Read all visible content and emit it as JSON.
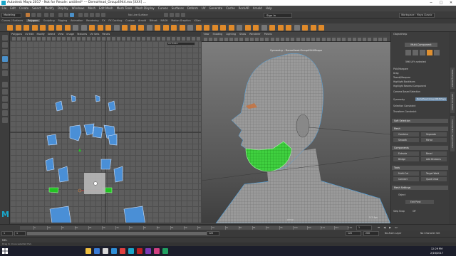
{
  "window": {
    "title": "Autodesk Maya 2017 - Not for Resale: untitled* --- DemoHead_Group4944.ma [XXX] ...",
    "minimize": "─",
    "maximize": "□",
    "close": "✕"
  },
  "menubar": [
    "File",
    "Edit",
    "Create",
    "Select",
    "Modify",
    "Display",
    "Windows",
    "Mesh",
    "Edit Mesh",
    "Mesh Tools",
    "Mesh Display",
    "Curves",
    "Surfaces",
    "Deform",
    "UV",
    "Generate",
    "Cache",
    "RockAR",
    "Arnold",
    "Help"
  ],
  "statusline": {
    "mode": "Modeling",
    "no_surface": "No Live Surface",
    "signin": "Sign In",
    "workspace": "Workspace : Maya Classic"
  },
  "shelf_tabs": [
    "Curves / Surfaces",
    "Polygons",
    "Sculpting",
    "Rigging",
    "Animation",
    "Rendering",
    "FX",
    "FX Caching",
    "Custom",
    "Arnold",
    "Bifrost",
    "MASH",
    "Motion Graphics",
    "XGen"
  ],
  "shelf_active_tab": "Polygons",
  "uv_editor": {
    "menu": [
      "Polygons",
      "UV Edit",
      "Modify",
      "Select",
      "View",
      "Image",
      "Textures",
      "UV Sets",
      "Panels"
    ],
    "texture_field": "UV Editor"
  },
  "viewport": {
    "menu": [
      "View",
      "Shading",
      "Lighting",
      "Show",
      "Renderer",
      "Panels"
    ],
    "label": "Symmetry : DemoHead:Group4944Shape",
    "fps": "5.2 fps",
    "camera": "persp"
  },
  "attribute_panel": {
    "menu": [
      "Object",
      "Help"
    ],
    "multi_component": "Multi-Component",
    "selected": "596 UV's selected",
    "pick_marquee": "Pick/Marquee",
    "options": [
      "Drag",
      "Tweak/Marquee",
      "Highlight Backfaces",
      "Highlight Nearest Component"
    ],
    "camera_based": "Camera Based Selection",
    "symmetry_label": "Symmetry",
    "symmetry_value": "DemoHead:Group4944Shape",
    "selection_constraint": "Selection Constraint",
    "transform_constraint": "Transform Constraint",
    "soft_selection": "Soft Selection",
    "mesh_section": "Mesh",
    "mesh_buttons": [
      "Combine",
      "Separate",
      "Smooth",
      "Mirror"
    ],
    "components_section": "Components",
    "component_buttons": [
      "Extrude",
      "Bevel",
      "Bridge",
      "Add Divisions"
    ],
    "tools_section": "Tools",
    "tool_buttons": [
      "Multi-Cut",
      "Target Weld",
      "Connect",
      "Quad Draw"
    ],
    "mesh_settings": "Mesh Settings",
    "object_label": "Object",
    "edit_pivot": "Edit Pivot",
    "step_snap": "Step Snap",
    "off": "Off"
  },
  "right_tabs": [
    "Modeling Toolkit",
    "Attribute Editor",
    "Channel Box / Layer Editor"
  ],
  "time_slider": {
    "start": "1",
    "end": "120",
    "ticks": [
      "5",
      "10",
      "15",
      "20",
      "25",
      "30",
      "35",
      "40",
      "45",
      "50",
      "55",
      "60",
      "65",
      "70",
      "75",
      "80",
      "85",
      "90",
      "95",
      "100",
      "105",
      "110",
      "115",
      "120"
    ]
  },
  "range_slider": {
    "start": "1",
    "range_start": "1",
    "range_end": "120",
    "end": "120",
    "anim_end": "200",
    "anim_layer": "No Anim Layer",
    "char_set": "No Character Set"
  },
  "cmdline": {
    "label": "MEL"
  },
  "helpline": "Drag to move selected UVs",
  "taskbar": {
    "time": "12:29 PM",
    "date": "2/16/2017"
  }
}
